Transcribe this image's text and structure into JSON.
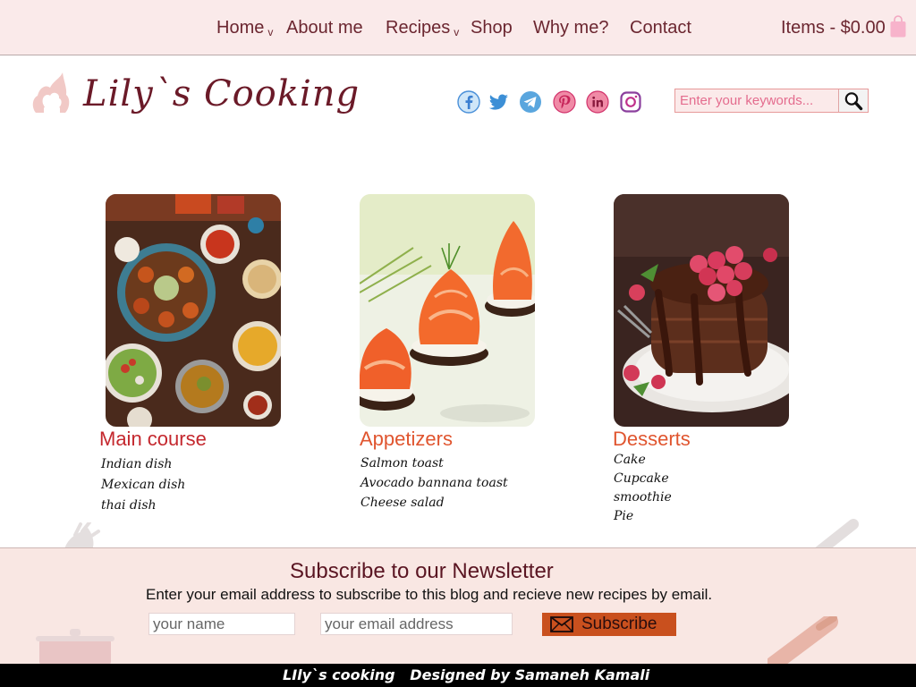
{
  "nav": {
    "items": [
      {
        "label": "Home",
        "caret": "v"
      },
      {
        "label": "About me"
      },
      {
        "label": "Recipes",
        "caret": "v"
      },
      {
        "label": "Shop"
      },
      {
        "label": "Why me?"
      },
      {
        "label": "Contact"
      }
    ],
    "cart_label": "Items - $0.00",
    "cart_icon": "shopping-bag-icon"
  },
  "header": {
    "logo_text": "Lily`s Cooking",
    "logo_icon": "chef-hat-icon",
    "social": [
      "facebook-icon",
      "twitter-icon",
      "telegram-icon",
      "pinterest-icon",
      "linkedin-icon",
      "instagram-icon"
    ],
    "search": {
      "placeholder": "Enter your keywords...",
      "icon": "magnifier-icon"
    }
  },
  "categories": [
    {
      "title": "Main course",
      "items": [
        "Indian dish",
        "Mexican dish",
        "thai dish"
      ]
    },
    {
      "title": "Appetizers",
      "items": [
        "Salmon toast",
        "Avocado bannana toast",
        "Cheese salad"
      ]
    },
    {
      "title": "Desserts",
      "items": [
        "Cake",
        "Cupcake",
        "smoothie",
        "Pie"
      ]
    }
  ],
  "newsletter": {
    "title": "Subscribe to our Newsletter",
    "subtitle": "Enter your email address to subscribe to this blog and recieve new recipes by email.",
    "name_placeholder": "your name",
    "email_placeholder": "your email address",
    "button_label": "Subscribe",
    "button_icon": "envelope-icon"
  },
  "footer": {
    "text": "LIly`s cooking   Designed by Samaneh Kamali"
  },
  "colors": {
    "nav_bg": "#faeaea",
    "brand": "#6b1a28",
    "category_title": "#c4282e",
    "button": "#c9501e",
    "newsletter_bg": "#f9e7e3",
    "footer_bg": "#000000"
  }
}
